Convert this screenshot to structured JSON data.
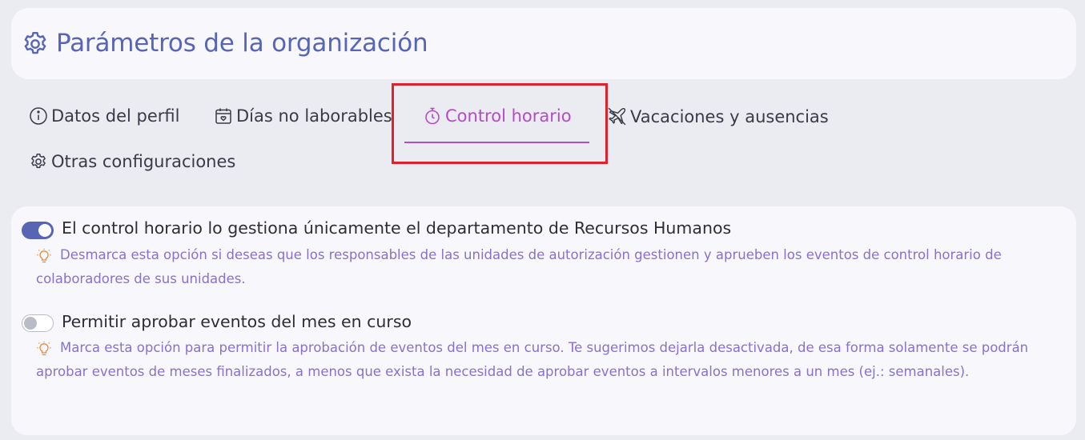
{
  "header": {
    "title": "Parámetros de la organización",
    "icon": "gear-icon"
  },
  "tabs": [
    {
      "label": "Datos del perfil",
      "icon": "info-icon",
      "active": false
    },
    {
      "label": "Días no laborables",
      "icon": "calendar-icon",
      "active": false
    },
    {
      "label": "Control horario",
      "icon": "stopwatch-icon",
      "active": true
    },
    {
      "label": "Vacaciones y ausencias",
      "icon": "airplane-icon",
      "active": false
    },
    {
      "label": "Otras configuraciones",
      "icon": "gear-icon",
      "active": false
    }
  ],
  "options": [
    {
      "label": "El control horario lo gestiona únicamente el departamento de Recursos Humanos",
      "enabled": true,
      "hint": "Desmarca esta opción si deseas que los responsables de las unidades de autorización gestionen y aprueben los eventos de control horario de colaboradores de sus unidades."
    },
    {
      "label": "Permitir aprobar eventos del mes en curso",
      "enabled": false,
      "hint": "Marca esta opción para permitir la aprobación de eventos del mes en curso. Te sugerimos dejarla desactivada, de esa forma solamente se podrán aprobar eventos de meses finalizados, a menos que exista la necesidad de aprobar eventos a intervalos menores a un mes (ej.: semanales)."
    }
  ],
  "colors": {
    "accent": "#5865b4",
    "active_tab": "#b54bc8",
    "hint_text": "#8a6fd0",
    "hint_icon": "#e8853a",
    "highlight": "#e0202a"
  }
}
